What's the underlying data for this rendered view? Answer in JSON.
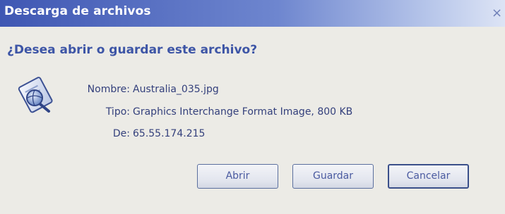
{
  "dialog": {
    "title": "Descarga de archivos",
    "close_symbol": "×",
    "question": "¿Desea abrir o guardar este archivo?",
    "icon": "file-download-icon"
  },
  "file": {
    "name_label": "Nombre:",
    "name_value": "Australia_035.jpg",
    "type_label": "Tipo:",
    "type_value": "Graphics Interchange Format Image, 800 KB",
    "from_label": "De:",
    "from_value": "65.55.174.215"
  },
  "buttons": {
    "open_label": "Abrir",
    "save_label": "Guardar",
    "cancel_label": "Cancelar"
  },
  "colors": {
    "title_gradient_start": "#3f57b3",
    "title_gradient_end": "#dde4f5",
    "background": "#ecebe6",
    "accent_text": "#3d55a6"
  }
}
